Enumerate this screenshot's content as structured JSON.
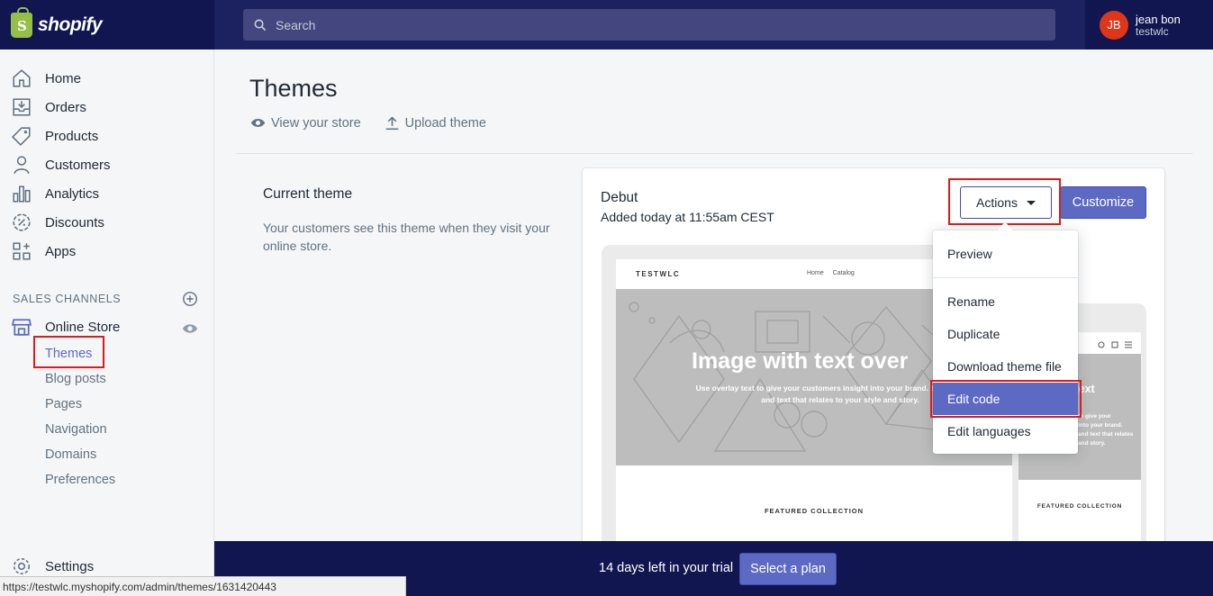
{
  "brand": {
    "name": "shopify"
  },
  "search": {
    "placeholder": "Search"
  },
  "user": {
    "initials": "JB",
    "name": "jean bon",
    "shop": "testwlc"
  },
  "sidebar": {
    "items": [
      {
        "label": "Home",
        "icon": "home-icon"
      },
      {
        "label": "Orders",
        "icon": "orders-icon"
      },
      {
        "label": "Products",
        "icon": "tag-icon"
      },
      {
        "label": "Customers",
        "icon": "person-icon"
      },
      {
        "label": "Analytics",
        "icon": "bar-chart-icon"
      },
      {
        "label": "Discounts",
        "icon": "discount-icon"
      },
      {
        "label": "Apps",
        "icon": "apps-icon"
      }
    ],
    "sales_channels_label": "SALES CHANNELS",
    "online_store": "Online Store",
    "sub_items": [
      "Themes",
      "Blog posts",
      "Pages",
      "Navigation",
      "Domains",
      "Preferences"
    ],
    "settings": "Settings"
  },
  "page": {
    "title": "Themes",
    "view_store": "View your store",
    "upload_theme": "Upload theme"
  },
  "current_theme": {
    "heading": "Current theme",
    "description": "Your customers see this theme when they visit your online store.",
    "name": "Debut",
    "added": "Added today at 11:55am CEST",
    "actions_label": "Actions",
    "customize_label": "Customize"
  },
  "preview": {
    "logo": "TESTWLC",
    "nav": [
      "Home",
      "Catalog"
    ],
    "hero_title": "Image with text over",
    "hero_sub": "Use overlay text to give your customers insight into your brand. Select imagery and text that relates to your style and story.",
    "featured": "FEATURED COLLECTION",
    "mobile_title": "with text\nlay",
    "mobile_sub": "to give your\ninto your brand.\nand text that relates\nand story.",
    "mobile_featured": "FEATURED COLLECTION"
  },
  "dropdown": {
    "items": [
      "Preview",
      "Rename",
      "Duplicate",
      "Download theme file",
      "Edit code",
      "Edit languages"
    ]
  },
  "trial": {
    "text": "14 days left in your trial",
    "button": "Select a plan"
  },
  "statusbar": {
    "url": "https://testwlc.myshopify.com/admin/themes/1631420443"
  },
  "colors": {
    "accent": "#5c6ac4",
    "topbar": "#1c2260",
    "highlight_box": "#e01b1b"
  }
}
